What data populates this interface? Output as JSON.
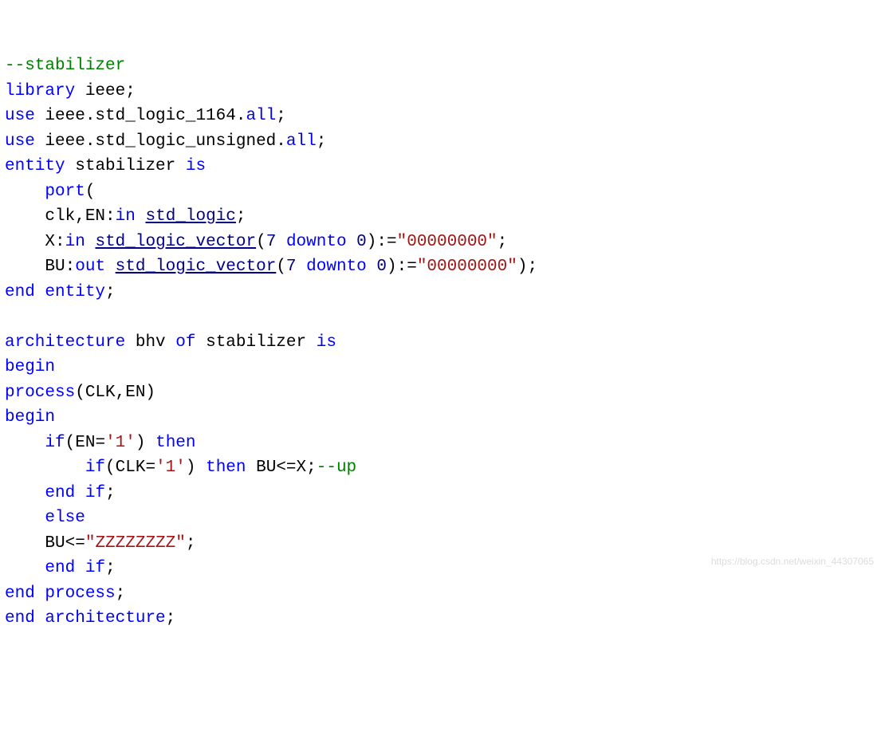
{
  "code": {
    "comment1": "--stabilizer",
    "kw_library": "library",
    "ieee": "ieee",
    "kw_use": "use",
    "ieee_std_logic_1164": "ieee.std_logic_1164.",
    "all": "all",
    "ieee_std_logic_unsigned": "ieee.std_logic_unsigned.",
    "kw_entity": "entity",
    "stabilizer": "stabilizer",
    "kw_is": "is",
    "kw_port": "port",
    "lparen": "(",
    "rparen": ")",
    "clk_en": "clk,EN",
    "colon": ":",
    "kw_in": "in",
    "type_std_logic": "std_logic",
    "semi": ";",
    "x": "X",
    "type_slv": "std_logic_vector",
    "num7": "7",
    "kw_downto": "downto",
    "num0": "0",
    "init_assign": ":=",
    "str_zeros": "\"00000000\"",
    "bu": "BU",
    "kw_out": "out",
    "kw_end": "end",
    "kw_architecture": "architecture",
    "bhv": "bhv",
    "kw_of": "of",
    "kw_begin": "begin",
    "kw_process": "process",
    "proc_sens": "(CLK,EN)",
    "kw_if": "if",
    "en_eq_1": "(EN=",
    "lit1": "'1'",
    "rparen_then": ")",
    "kw_then": "then",
    "clk_eq_1": "(CLK=",
    "bu_le_x": " BU<=X;",
    "comment_up": "--up",
    "kw_else": "else",
    "bu_le": "BU<=",
    "str_zzz": "\"ZZZZZZZZ\""
  },
  "watermark": "https://blog.csdn.net/weixin_44307065"
}
